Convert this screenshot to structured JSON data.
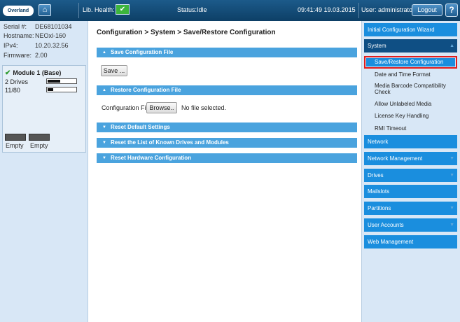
{
  "topbar": {
    "logo_text": "Overland Storage",
    "lib_health_label": "Lib. Health:",
    "status_label": "Status:",
    "status_value": "Idle",
    "datetime": "09:41:49 19.03.2015",
    "user_label": "User: administrator",
    "logout_label": "Logout",
    "help_label": "?"
  },
  "left": {
    "serial_label": "Serial #:",
    "serial_value": "DE68101034",
    "hostname_label": "Hostname:",
    "hostname_value": "NEOxl-160",
    "ipv4_label": "IPv4:",
    "ipv4_value": "10.20.32.56",
    "firmware_label": "Firmware:",
    "firmware_value": "2.00",
    "module": {
      "title": "Module 1 (Base)",
      "drives_label": "2 Drives",
      "drives_fill": 0.45,
      "slots_label": "11/80",
      "slots_fill": 0.2,
      "slot1_label": "Empty",
      "slot2_label": "Empty"
    }
  },
  "main": {
    "page_title": "Configuration > System > Save/Restore Configuration",
    "sections": {
      "save": "Save Configuration File",
      "restore": "Restore Configuration File",
      "reset_defaults": "Reset Default Settings",
      "reset_drives": "Reset the List of Known Drives and Modules",
      "reset_hardware": "Reset Hardware Configuration"
    },
    "save_button": "Save ...",
    "config_file_label": "Configuration File",
    "browse_button": "Browse..",
    "no_file_text": "No file selected."
  },
  "nav": {
    "wizard": "Initial Configuration Wizard",
    "system": "System",
    "system_items": [
      "Save/Restore Configuration",
      "Date and Time Format",
      "Media Barcode Compatibility Check",
      "Allow Unlabeled Media",
      "License Key Handling",
      "RMI Timeout"
    ],
    "network": "Network",
    "network_management": "Network Management",
    "drives": "Drives",
    "mailslots": "Mailslots",
    "partitions": "Partitions",
    "user_accounts": "User Accounts",
    "web_management": "Web Management"
  },
  "colors": {
    "topbar": "#0d3f66",
    "section_header": "#4aa3de",
    "nav_button": "#1a8ede",
    "nav_active": "#0f4f84",
    "selected_outline": "#e01c1c",
    "sidebar_bg": "#d8e7f6"
  }
}
